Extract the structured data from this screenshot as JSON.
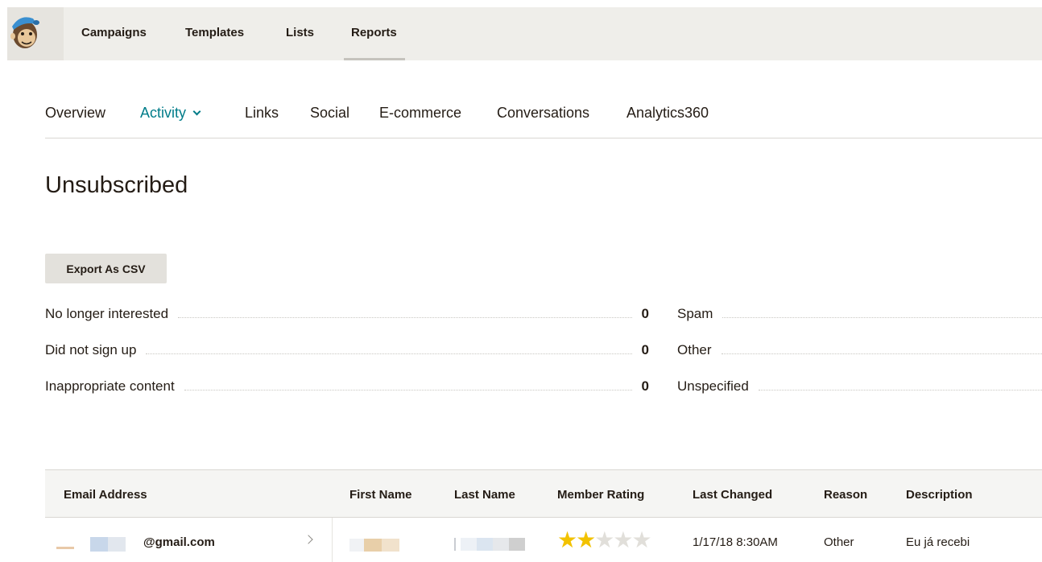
{
  "topnav": {
    "items": [
      "Campaigns",
      "Templates",
      "Lists",
      "Reports"
    ],
    "active": "Reports"
  },
  "subnav": {
    "items": [
      "Overview",
      "Activity",
      "Links",
      "Social",
      "E-commerce",
      "Conversations",
      "Analytics360"
    ],
    "active": "Activity"
  },
  "page": {
    "title": "Unsubscribed",
    "export_label": "Export As CSV"
  },
  "stats": {
    "left": [
      {
        "label": "No longer interested",
        "value": "0"
      },
      {
        "label": "Did not sign up",
        "value": "0"
      },
      {
        "label": "Inappropriate content",
        "value": "0"
      }
    ],
    "right": [
      {
        "label": "Spam"
      },
      {
        "label": "Other"
      },
      {
        "label": "Unspecified"
      }
    ]
  },
  "table": {
    "headers": {
      "email": "Email Address",
      "first_name": "First Name",
      "last_name": "Last Name",
      "rating": "Member Rating",
      "last_changed": "Last Changed",
      "reason": "Reason",
      "description": "Description"
    },
    "rows": [
      {
        "email": "@gmail.com",
        "rating": 2,
        "rating_max": 5,
        "last_changed": "1/17/18 8:30AM",
        "reason": "Other",
        "description": "Eu já recebi"
      }
    ]
  },
  "colors": {
    "accent": "#007c89",
    "star": "#f2c200",
    "topbar_bg": "#efeeea"
  }
}
